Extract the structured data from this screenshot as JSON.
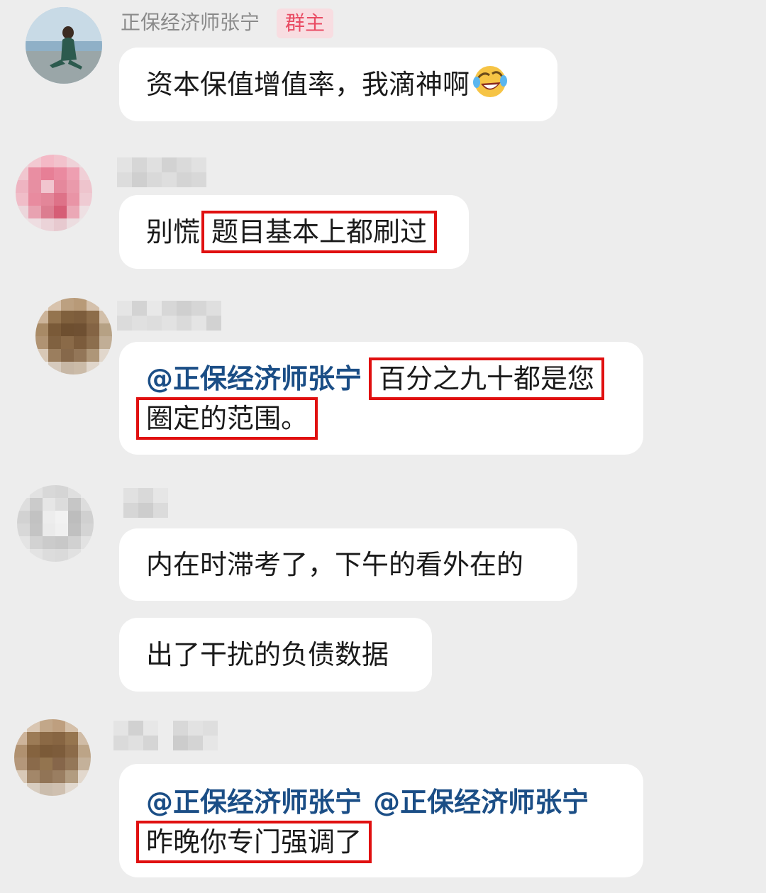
{
  "messages": [
    {
      "sender": "正保经济师张宁",
      "badge": "群主",
      "text": "资本保值增值率，我滴神啊",
      "emoji": "rolling-laughing-emoji"
    },
    {
      "text_plain": "别慌",
      "text_highlight": "题目基本上都刷过"
    },
    {
      "mention": "@正保经济师张宁",
      "text_highlight_1": "百分之九十都是您",
      "text_highlight_2": "圈定的范围。"
    },
    {
      "text": "内在时滞考了，下午的看外在的"
    },
    {
      "text": "出了干扰的负债数据"
    },
    {
      "mention_1": "@正保经济师张宁",
      "mention_2": "@正保经济师张宁",
      "text_highlight": "昨晚你专门强调了"
    }
  ],
  "colors": {
    "background": "#EDEDED",
    "bubble": "#FFFFFF",
    "mention": "#1B4E86",
    "badge_text": "#E94B63",
    "badge_bg": "#F8DDE1",
    "highlight_box": "#E01010"
  }
}
